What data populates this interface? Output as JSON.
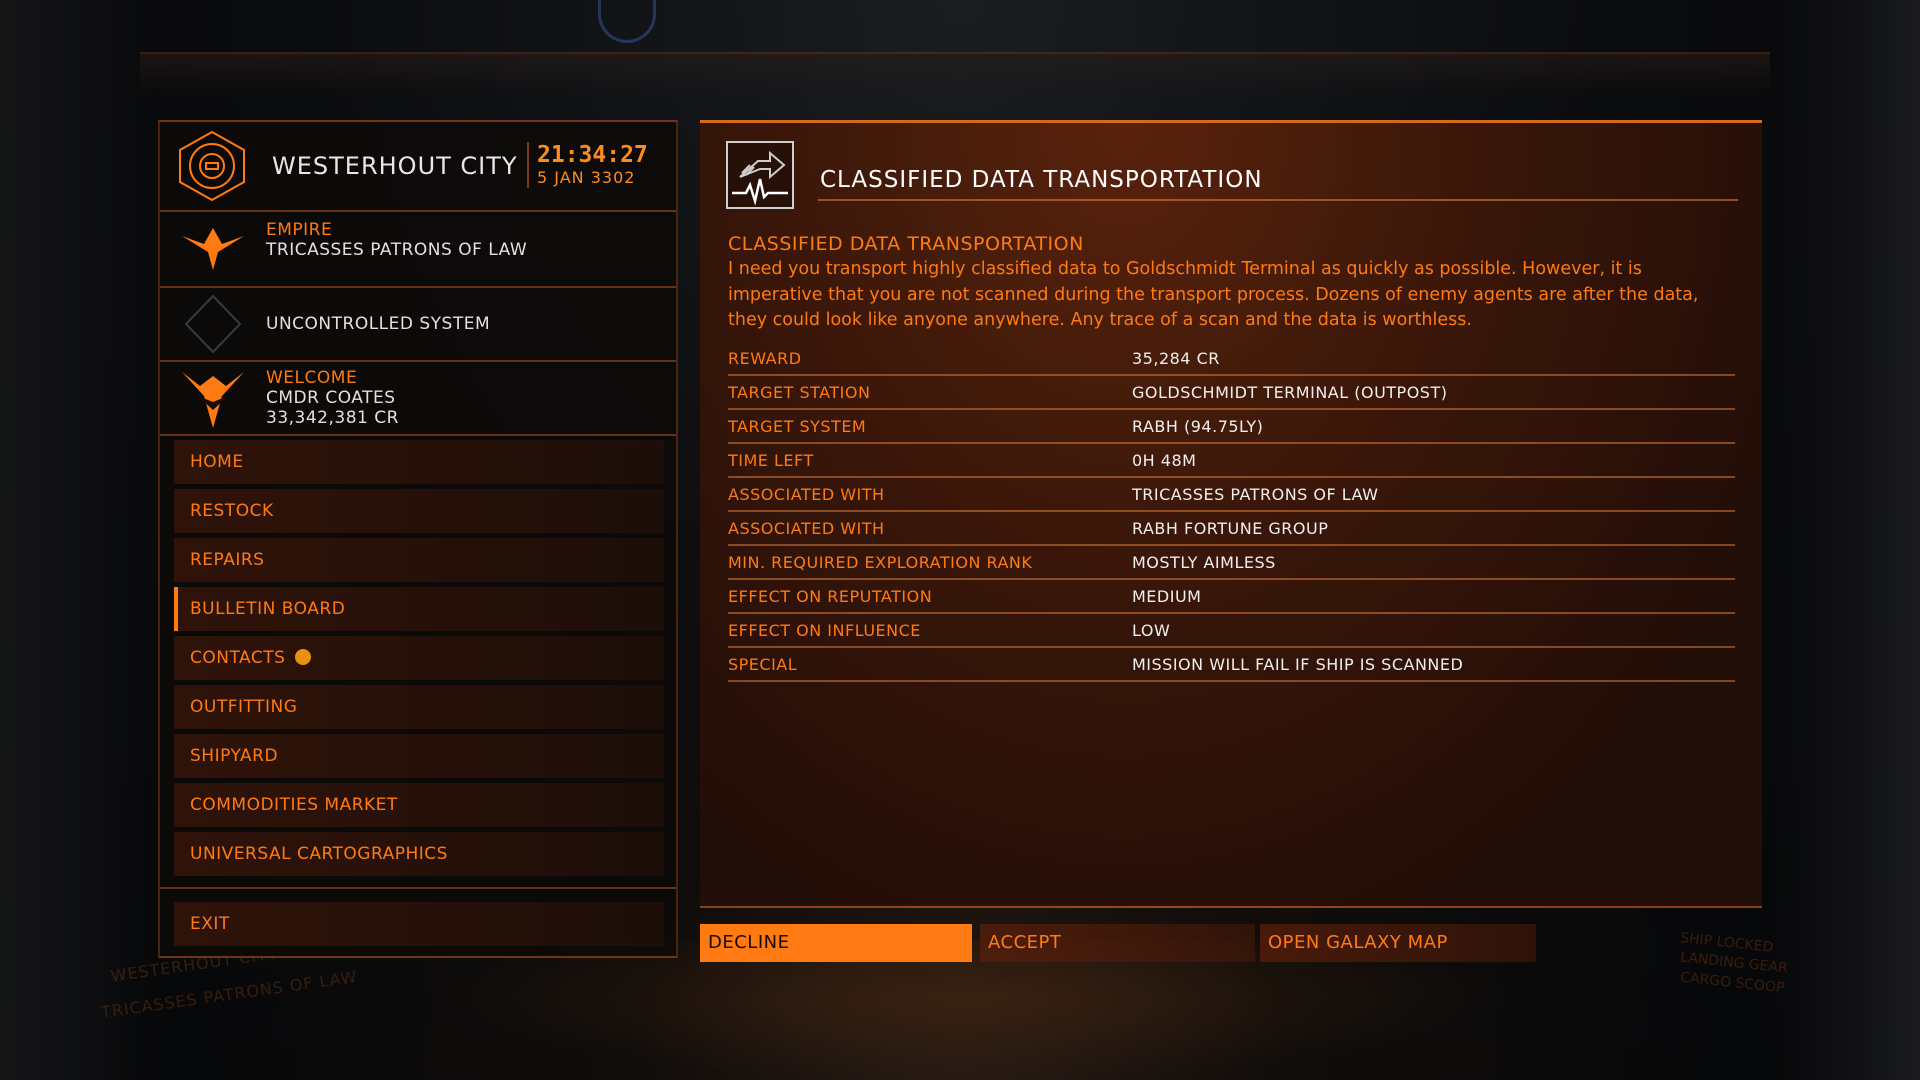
{
  "station": {
    "name": "WESTERHOUT CITY",
    "time": "21:34:27",
    "date": "5 JAN 3302",
    "icon": "station-coriolis-icon"
  },
  "faction": {
    "superpower": "EMPIRE",
    "name": "TRICASSES PATRONS OF LAW",
    "icon": "empire-emblem-icon"
  },
  "system": {
    "status": "UNCONTROLLED SYSTEM",
    "icon": "diamond-outline-icon"
  },
  "commander": {
    "greeting": "WELCOME",
    "name": "CMDR COATES",
    "credits": "33,342,381 CR",
    "icon": "elite-rank-emblem-icon"
  },
  "nav": {
    "items": [
      {
        "label": "HOME"
      },
      {
        "label": "RESTOCK"
      },
      {
        "label": "REPAIRS"
      },
      {
        "label": "BULLETIN BOARD",
        "active": true
      },
      {
        "label": "CONTACTS",
        "notification": true
      },
      {
        "label": "OUTFITTING"
      },
      {
        "label": "SHIPYARD"
      },
      {
        "label": "COMMODITIES MARKET"
      },
      {
        "label": "UNIVERSAL CARTOGRAPHICS"
      }
    ],
    "exit": "EXIT"
  },
  "mission": {
    "panel_title": "CLASSIFIED DATA TRANSPORTATION",
    "heading": "CLASSIFIED DATA TRANSPORTATION",
    "description": "I need you transport highly classified data to Goldschmidt Terminal as quickly as possible. However, it is imperative that you are not scanned during the transport process. Dozens of enemy agents are after the data, they could look like anyone anywhere. Any trace of a scan and the data is worthless.",
    "icon": "data-transport-icon",
    "details": [
      {
        "label": "REWARD",
        "value": "35,284 CR"
      },
      {
        "label": "TARGET STATION",
        "value": "GOLDSCHMIDT TERMINAL (OUTPOST)"
      },
      {
        "label": "TARGET SYSTEM",
        "value": "RABH (94.75LY)"
      },
      {
        "label": "TIME LEFT",
        "value": "0H 48M"
      },
      {
        "label": "ASSOCIATED WITH",
        "value": "TRICASSES PATRONS OF LAW"
      },
      {
        "label": "ASSOCIATED WITH",
        "value": "RABH FORTUNE GROUP"
      },
      {
        "label": "MIN. REQUIRED EXPLORATION RANK",
        "value": "MOSTLY AIMLESS"
      },
      {
        "label": "EFFECT ON REPUTATION",
        "value": "MEDIUM"
      },
      {
        "label": "EFFECT ON INFLUENCE",
        "value": "LOW"
      },
      {
        "label": "SPECIAL",
        "value": "MISSION WILL FAIL IF SHIP IS SCANNED"
      }
    ]
  },
  "buttons": {
    "decline": "DECLINE",
    "accept": "ACCEPT",
    "galaxy_map": "OPEN GALAXY MAP"
  },
  "background_hud": {
    "left_line1": "WESTERHOUT CITY",
    "left_line2": "TRICASSES PATRONS OF LAW",
    "right_line1": "SHIP LOCKED",
    "right_line2": "LANDING GEAR",
    "right_line3": "CARGO SCOOP"
  },
  "colors": {
    "accent_orange": "#ff7a12",
    "panel_border": "#d46a1c",
    "text_white": "#f1efec"
  }
}
